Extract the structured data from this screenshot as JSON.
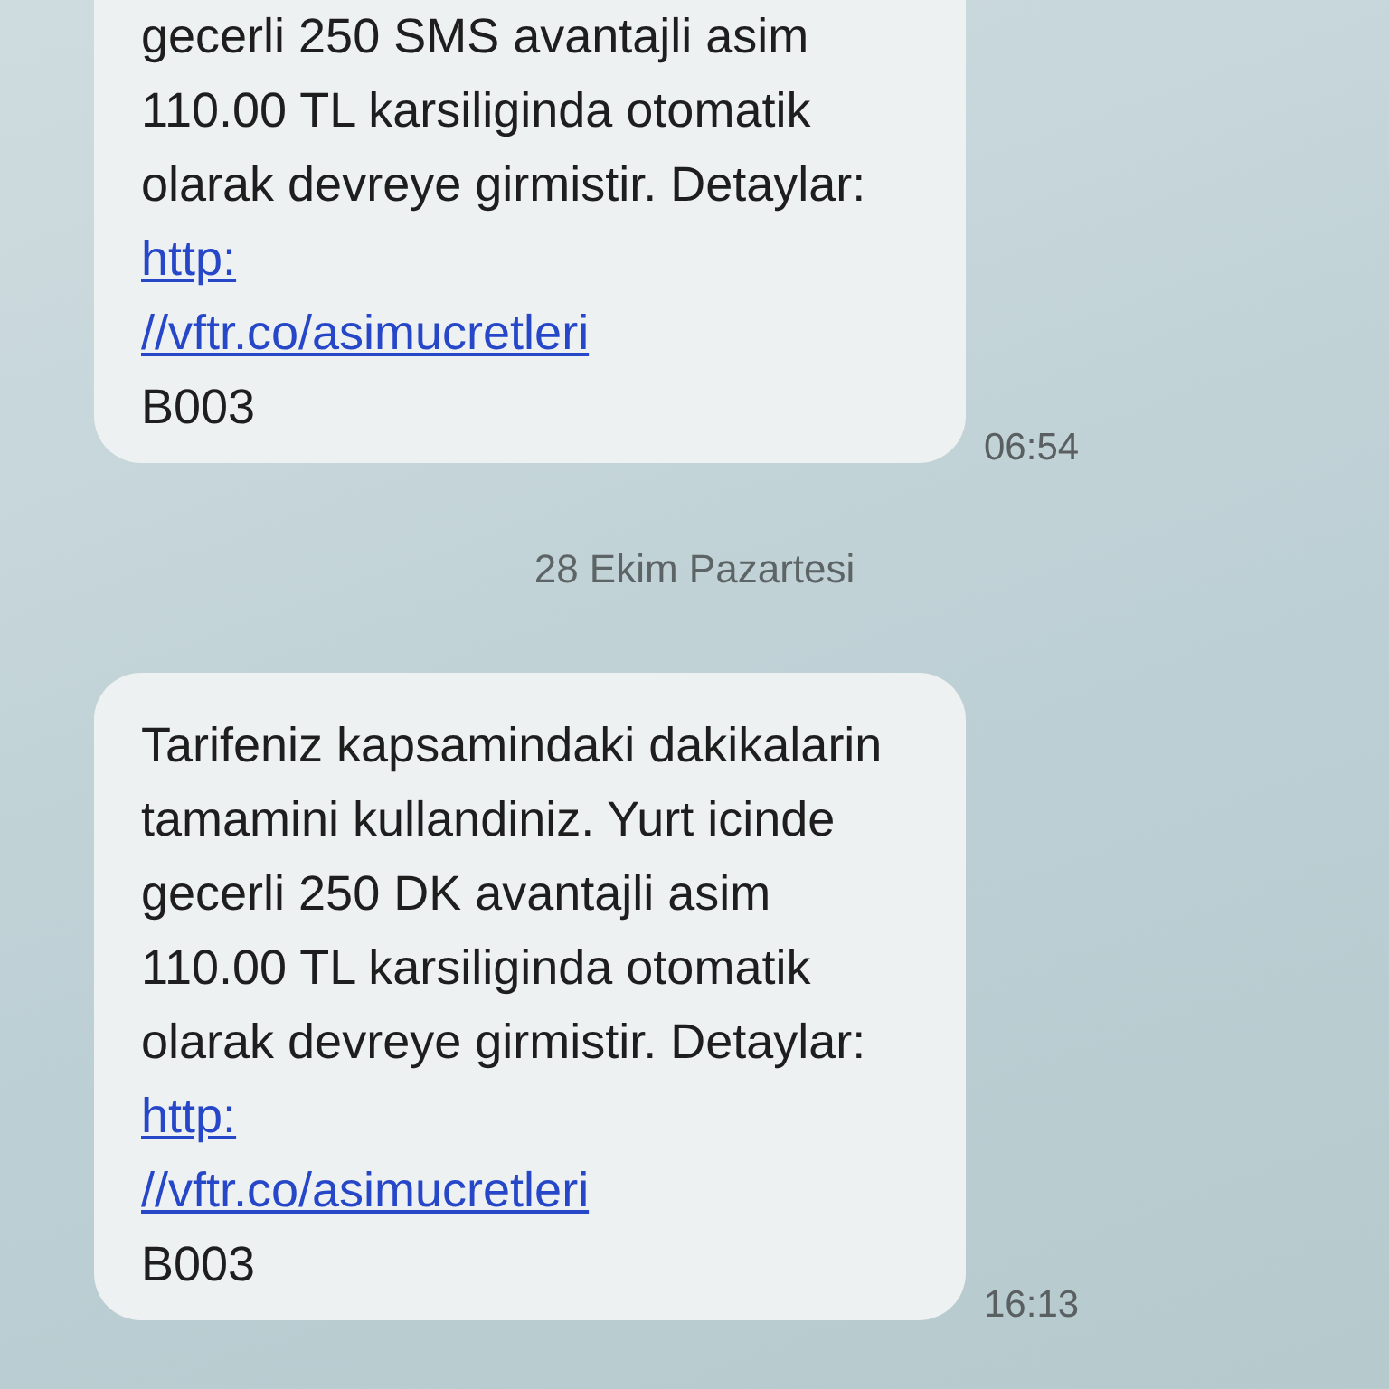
{
  "messages": [
    {
      "text": "gecerli 250 SMS avantajli asim 110.00 TL karsiliginda otomatik olarak devreye girmistir. Detaylar:",
      "link_parts": [
        "http:",
        "//vftr.co/asimucretleri"
      ],
      "code": "B003",
      "time": "06:54"
    },
    {
      "date_separator": "28 Ekim Pazartesi"
    },
    {
      "text": "Tarifeniz kapsamindaki dakikalarin tamamini kullandiniz. Yurt icinde gecerli 250 DK avantajli asim 110.00 TL karsiliginda otomatik olarak devreye girmistir. Detaylar:",
      "link_parts": [
        "http:",
        "//vftr.co/asimucretleri"
      ],
      "code": "B003",
      "time": "16:13"
    }
  ]
}
